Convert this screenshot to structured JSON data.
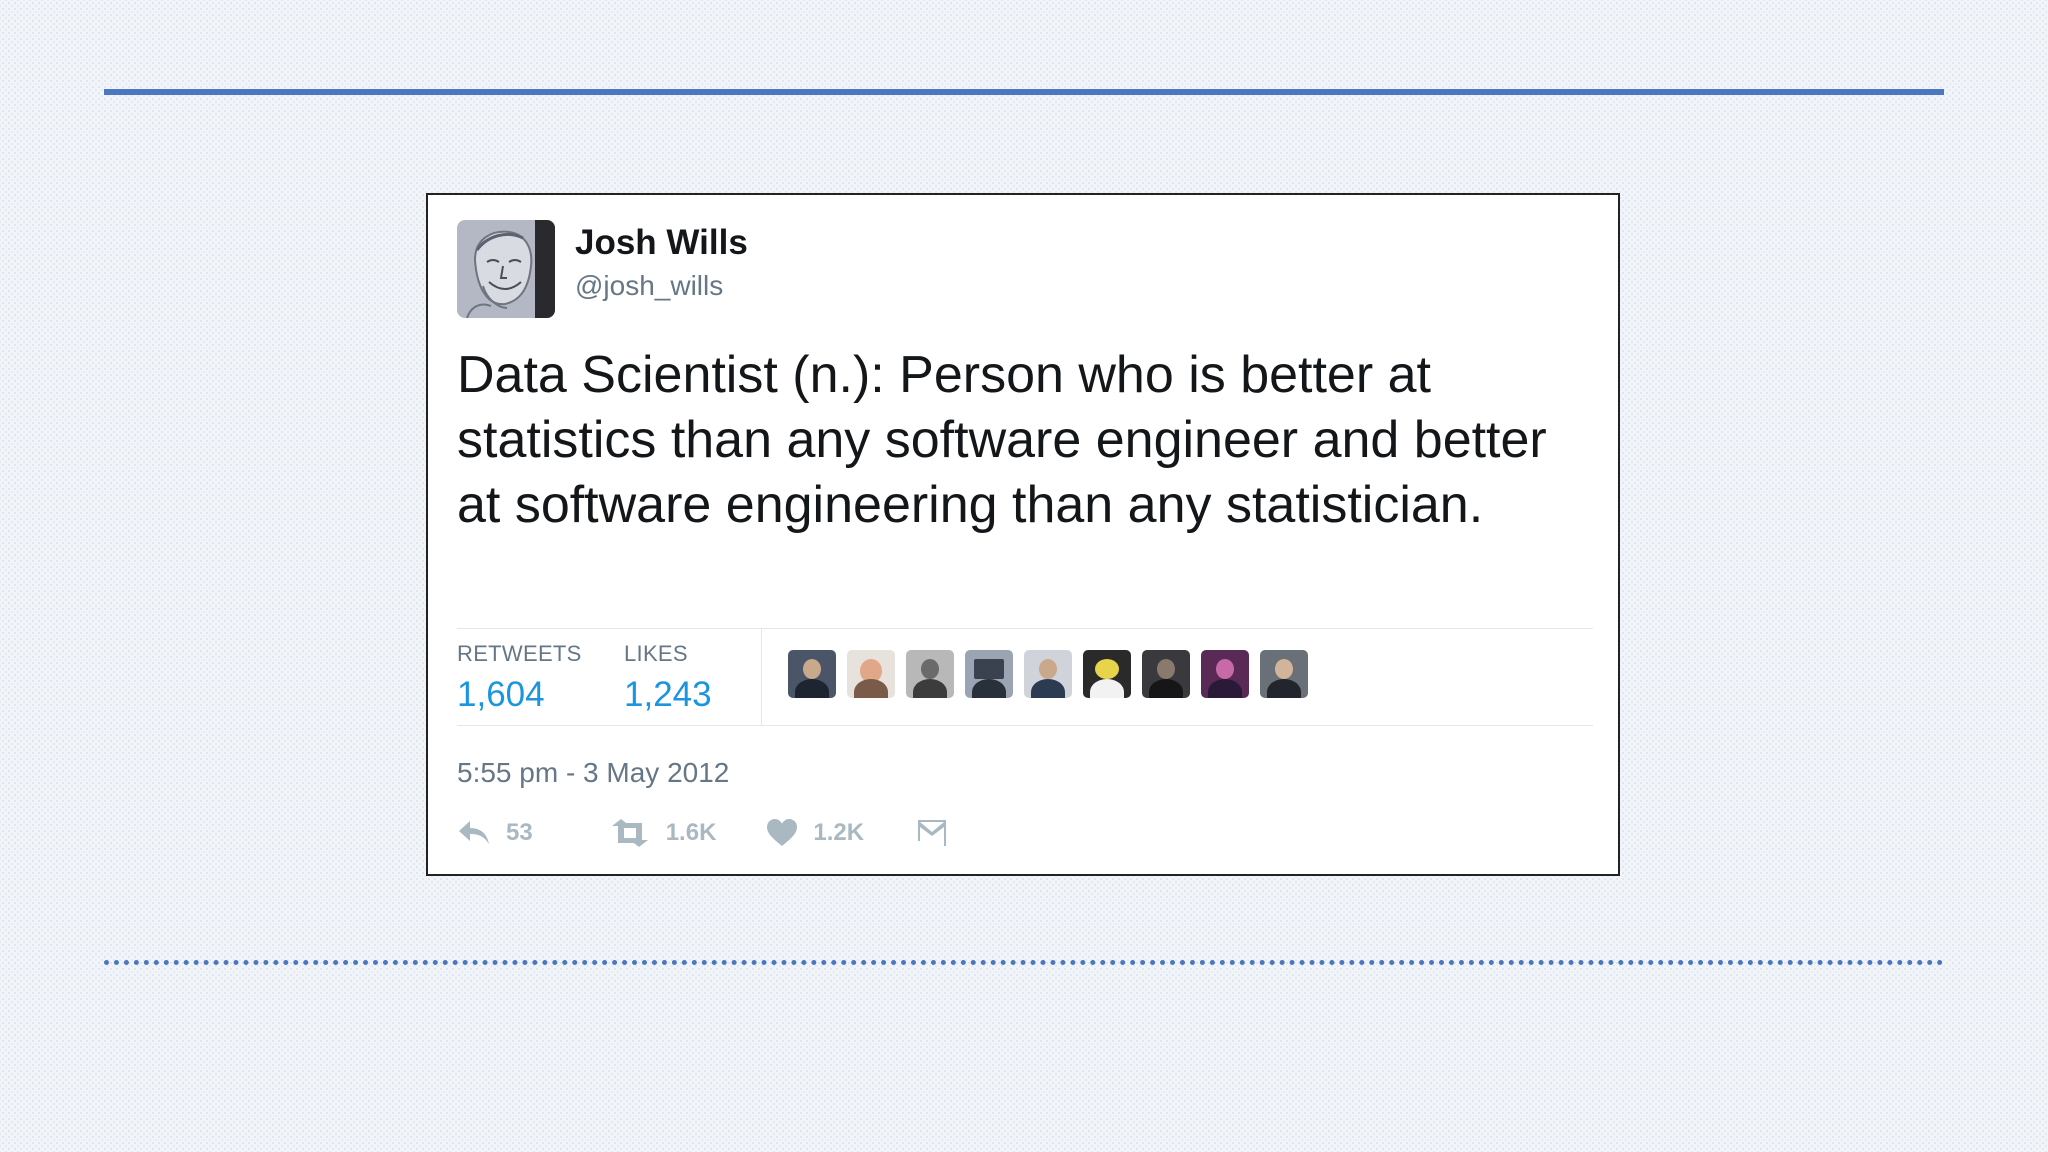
{
  "tweet": {
    "author_name": "Josh Wills",
    "author_handle": "@josh_wills",
    "text": "Data Scientist (n.): Person who is better at statistics than any software engineer and better at software engineering than any statistician.",
    "stats": {
      "retweets_label": "RETWEETS",
      "retweets_value": "1,604",
      "likes_label": "LIKES",
      "likes_value": "1,243"
    },
    "liker_avatar_count": 9,
    "timestamp": "5:55 pm - 3 May 2012",
    "actions": {
      "reply_count": "53",
      "retweet_count": "1.6K",
      "like_count": "1.2K"
    }
  },
  "colors": {
    "accent_rule": "#4a77c0",
    "stat_value": "#1b95e0",
    "muted_text": "#657786",
    "action_icon": "#aab8c2"
  }
}
